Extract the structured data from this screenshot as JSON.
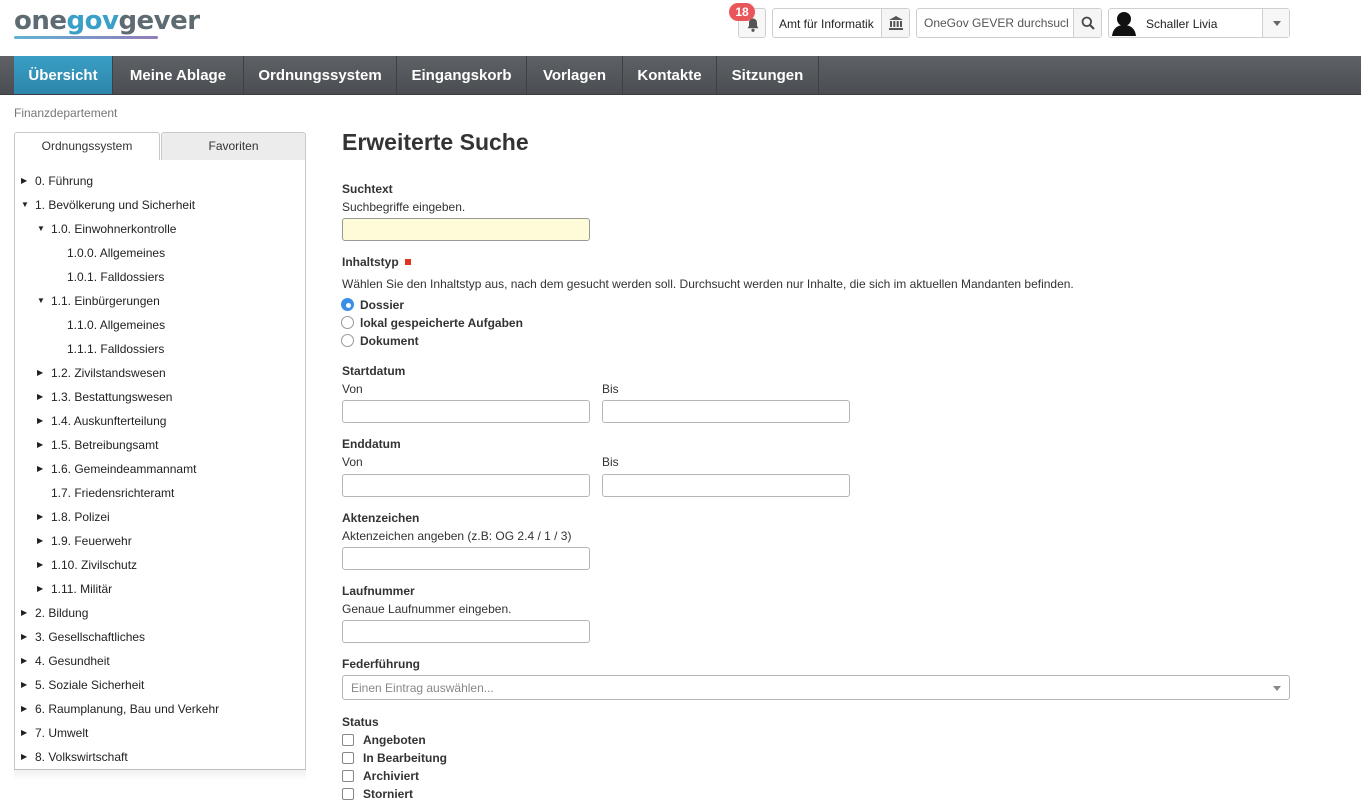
{
  "app": {
    "logo": {
      "part1": "one",
      "part2": "gov",
      "part3": "gever"
    },
    "notifications": {
      "count": "18"
    },
    "org_unit": "Amt für Informatik",
    "search": {
      "placeholder": "OneGov GEVER durchsuchen"
    },
    "user": {
      "name": "Schaller Livia"
    }
  },
  "nav": {
    "items": [
      "Übersicht",
      "Meine Ablage",
      "Ordnungssystem",
      "Eingangskorb",
      "Vorlagen",
      "Kontakte",
      "Sitzungen"
    ],
    "active": "Übersicht"
  },
  "breadcrumb": "Finanzdepartement",
  "sidebar": {
    "tabs": [
      "Ordnungssystem",
      "Favoriten"
    ],
    "tree": [
      {
        "label": "0. Führung",
        "level": 0,
        "arrow": "collapsed"
      },
      {
        "label": "1. Bevölkerung und Sicherheit",
        "level": 0,
        "arrow": "expanded"
      },
      {
        "label": "1.0. Einwohnerkontrolle",
        "level": 1,
        "arrow": "expanded"
      },
      {
        "label": "1.0.0. Allgemeines",
        "level": 2,
        "arrow": "none"
      },
      {
        "label": "1.0.1. Falldossiers",
        "level": 2,
        "arrow": "none"
      },
      {
        "label": "1.1. Einbürgerungen",
        "level": 1,
        "arrow": "expanded"
      },
      {
        "label": "1.1.0. Allgemeines",
        "level": 2,
        "arrow": "none"
      },
      {
        "label": "1.1.1. Falldossiers",
        "level": 2,
        "arrow": "none"
      },
      {
        "label": "1.2. Zivilstandswesen",
        "level": 1,
        "arrow": "collapsed"
      },
      {
        "label": "1.3. Bestattungswesen",
        "level": 1,
        "arrow": "collapsed"
      },
      {
        "label": "1.4. Auskunfterteilung",
        "level": 1,
        "arrow": "collapsed"
      },
      {
        "label": "1.5. Betreibungsamt",
        "level": 1,
        "arrow": "collapsed"
      },
      {
        "label": "1.6. Gemeindeammannamt",
        "level": 1,
        "arrow": "collapsed"
      },
      {
        "label": "1.7. Friedensrichteramt",
        "level": 1,
        "arrow": "none"
      },
      {
        "label": "1.8. Polizei",
        "level": 1,
        "arrow": "collapsed"
      },
      {
        "label": "1.9. Feuerwehr",
        "level": 1,
        "arrow": "collapsed"
      },
      {
        "label": "1.10. Zivilschutz",
        "level": 1,
        "arrow": "collapsed"
      },
      {
        "label": "1.11. Militär",
        "level": 1,
        "arrow": "collapsed"
      },
      {
        "label": "2. Bildung",
        "level": 0,
        "arrow": "collapsed"
      },
      {
        "label": "3. Gesellschaftliches",
        "level": 0,
        "arrow": "collapsed"
      },
      {
        "label": "4. Gesundheit",
        "level": 0,
        "arrow": "collapsed"
      },
      {
        "label": "5. Soziale Sicherheit",
        "level": 0,
        "arrow": "collapsed"
      },
      {
        "label": "6. Raumplanung, Bau und Verkehr",
        "level": 0,
        "arrow": "collapsed"
      },
      {
        "label": "7. Umwelt",
        "level": 0,
        "arrow": "collapsed"
      },
      {
        "label": "8. Volkswirtschaft",
        "level": 0,
        "arrow": "collapsed"
      }
    ]
  },
  "form": {
    "title": "Erweiterte Suche",
    "suchtext": {
      "label": "Suchtext",
      "help": "Suchbegriffe eingeben.",
      "value": ""
    },
    "inhaltstyp": {
      "label": "Inhaltstyp",
      "help": "Wählen Sie den Inhaltstyp aus, nach dem gesucht werden soll. Durchsucht werden nur Inhalte, die sich im aktuellen Mandanten befinden.",
      "options": [
        "Dossier",
        "lokal gespeicherte Aufgaben",
        "Dokument"
      ],
      "selected": "Dossier"
    },
    "startdatum": {
      "label": "Startdatum",
      "von": "Von",
      "bis": "Bis"
    },
    "enddatum": {
      "label": "Enddatum",
      "von": "Von",
      "bis": "Bis"
    },
    "aktenzeichen": {
      "label": "Aktenzeichen",
      "help": "Aktenzeichen angeben (z.B: OG 2.4 / 1 / 3)"
    },
    "laufnummer": {
      "label": "Laufnummer",
      "help": "Genaue Laufnummer eingeben."
    },
    "federfuehrung": {
      "label": "Federführung",
      "placeholder": "Einen Eintrag auswählen..."
    },
    "status": {
      "label": "Status",
      "options": [
        "Angeboten",
        "In Bearbeitung",
        "Archiviert",
        "Storniert"
      ]
    }
  },
  "colors": {
    "accent": "#2d8fb8",
    "nav_bg": "#54575b",
    "required": "#dd3322",
    "suchtext_bg": "#fefbd8",
    "badge": "#e8555a"
  }
}
